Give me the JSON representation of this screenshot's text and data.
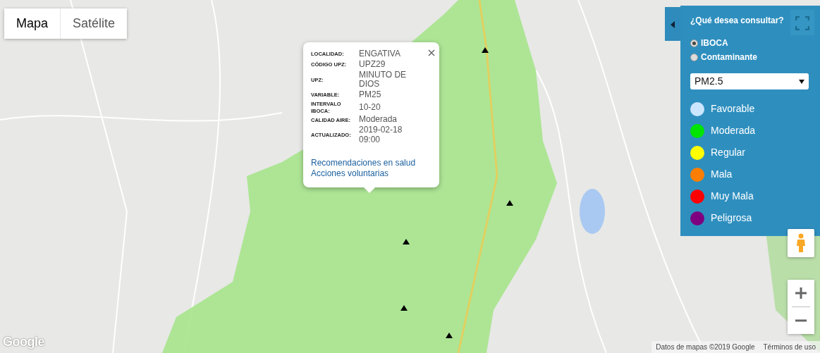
{
  "map_type": [
    {
      "label": "Mapa",
      "selected": true
    },
    {
      "label": "Satélite",
      "selected": false
    }
  ],
  "popup": {
    "fields": [
      {
        "label": "LOCALIDAD:",
        "value": "ENGATIVA"
      },
      {
        "label": "CÓDIGO UPZ:",
        "value": "UPZ29"
      },
      {
        "label": "UPZ:",
        "value": "MINUTO DE DIOS"
      },
      {
        "label": "VARIABLE:",
        "value": "PM25"
      },
      {
        "label": "INTERVALO IBOCA:",
        "value": "10-20"
      },
      {
        "label": "CALIDAD AIRE:",
        "value": "Moderada"
      },
      {
        "label": "ACTUALIZADO:",
        "value": "2019-02-18 09:00"
      }
    ],
    "links": [
      "Recomendaciones en salud",
      "Acciones voluntarias"
    ]
  },
  "panel": {
    "title": "¿Qué desea consultar?",
    "options": [
      {
        "label": "IBOCA",
        "selected": true
      },
      {
        "label": "Contaminante",
        "selected": false
      }
    ],
    "pollutant": "PM2.5",
    "legend": [
      {
        "label": "Favorable",
        "color": "#cce5ff"
      },
      {
        "label": "Moderada",
        "color": "#00e400"
      },
      {
        "label": "Regular",
        "color": "#ffff00"
      },
      {
        "label": "Mala",
        "color": "#ff7e00"
      },
      {
        "label": "Muy Mala",
        "color": "#ff0000"
      },
      {
        "label": "Peligrosa",
        "color": "#7e0080"
      }
    ]
  },
  "logo": "Google",
  "attribution": "Datos de mapas ©2019 Google",
  "terms": "Términos de uso"
}
